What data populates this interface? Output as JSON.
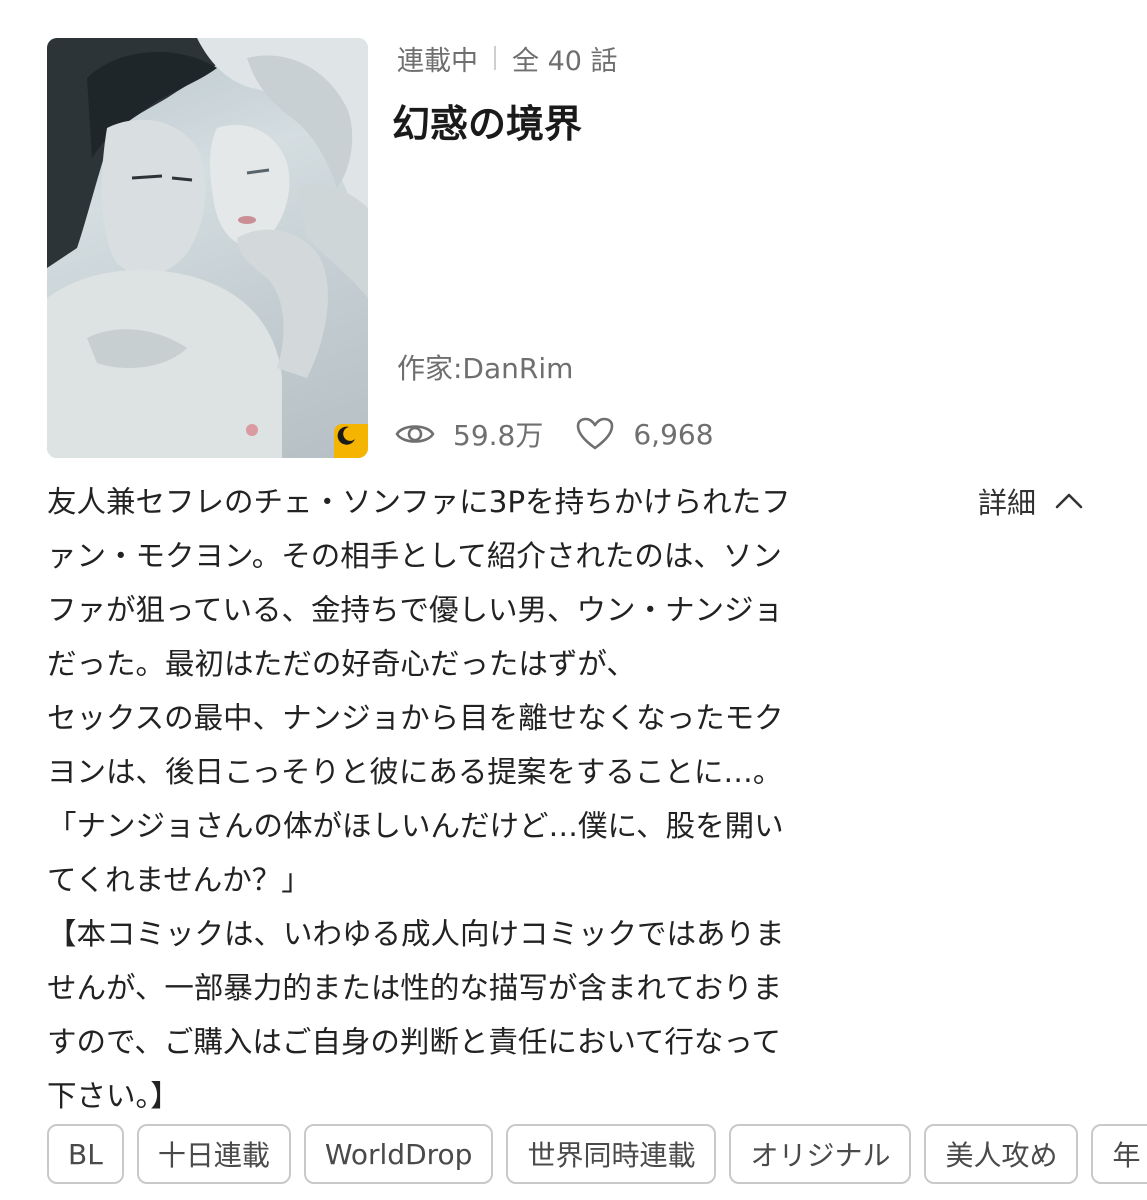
{
  "series": {
    "status": "連載中",
    "episodes": "全 40 話",
    "title": "幻惑の境界",
    "author": "作家:DanRim",
    "views": "59.8万",
    "likes": "6,968"
  },
  "description": {
    "lines": [
      "友人兼セフレのチェ・ソンファに3Pを持ちかけられたフ",
      "ァン・モクヨン。その相手として紹介されたのは、ソン",
      "ファが狙っている、金持ちで優しい男、ウン・ナンジョ",
      "だった。最初はただの好奇心だったはずが、",
      "セックスの最中、ナンジョから目を離せなくなったモク",
      "ヨンは、後日こっそりと彼にある提案をすることに…。",
      "「ナンジョさんの体がほしいんだけど…僕に、股を開い",
      "てくれませんか？」",
      "【本コミックは、いわゆる成人向けコミックではありま",
      "せんが、一部暴力的または性的な描写が含まれておりま",
      "すので、ご購入はご自身の判断と責任において行なって",
      "下さい。】"
    ],
    "toggle_label": "詳細"
  },
  "tags": [
    "BL",
    "十日連載",
    "WorldDrop",
    "世界同時連載",
    "オリジナル",
    "美人攻め",
    "年"
  ],
  "icons": {
    "views": "eye-icon",
    "likes": "heart-icon",
    "badge": "moon-icon",
    "toggle": "chevron-up-icon"
  },
  "colors": {
    "badge": "#f4b400",
    "meta_text": "#6f6f6f",
    "tag_border": "#c9c9c9"
  }
}
